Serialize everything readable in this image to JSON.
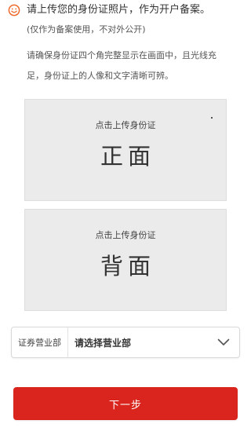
{
  "notice": {
    "icon": "smile-icon",
    "main": "请上传您的身份证照片，作为开户备案。",
    "sub": "(仅作为备案使用，不对外公开)",
    "detail_line1": "请确保身份证四个角完整显示在画面中，且光线充",
    "detail_line2": "足，身份证上的人像和文字清晰可辨。"
  },
  "upload": {
    "front": {
      "hint": "点击上传身份证",
      "side": "正面"
    },
    "back": {
      "hint": "点击上传身份证",
      "side": "背面"
    }
  },
  "branch": {
    "label": "证券营业部",
    "value": "请选择营业部",
    "icon": "chevron-down-icon"
  },
  "actions": {
    "next_label": "下一步"
  },
  "colors": {
    "accent": "#d9251d",
    "icon_orange": "#ee6a2a",
    "card_bg": "#ebebeb"
  }
}
